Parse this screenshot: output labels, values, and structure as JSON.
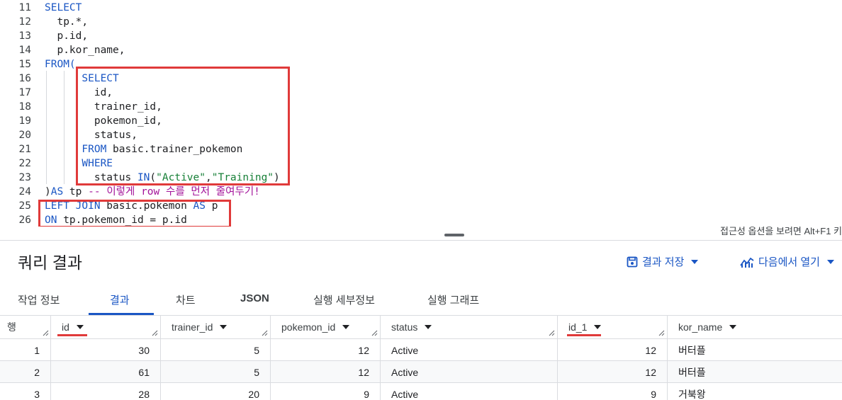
{
  "editor": {
    "lines": [
      {
        "num": "11",
        "tokens": [
          {
            "t": "SELECT",
            "c": "kw"
          }
        ]
      },
      {
        "num": "12",
        "tokens": [
          {
            "t": "  tp.*,",
            "c": "plain"
          }
        ]
      },
      {
        "num": "13",
        "tokens": [
          {
            "t": "  p.id,",
            "c": "plain"
          }
        ]
      },
      {
        "num": "14",
        "tokens": [
          {
            "t": "  p.kor_name,",
            "c": "plain"
          }
        ]
      },
      {
        "num": "15",
        "tokens": [
          {
            "t": "FROM(",
            "c": "kw"
          }
        ]
      },
      {
        "num": "16",
        "tokens": [
          {
            "t": "      ",
            "c": "plain"
          },
          {
            "t": "SELECT",
            "c": "kw"
          }
        ]
      },
      {
        "num": "17",
        "tokens": [
          {
            "t": "        id,",
            "c": "plain"
          }
        ]
      },
      {
        "num": "18",
        "tokens": [
          {
            "t": "        trainer_id,",
            "c": "plain"
          }
        ]
      },
      {
        "num": "19",
        "tokens": [
          {
            "t": "        pokemon_id,",
            "c": "plain"
          }
        ]
      },
      {
        "num": "20",
        "tokens": [
          {
            "t": "        status,",
            "c": "plain"
          }
        ]
      },
      {
        "num": "21",
        "tokens": [
          {
            "t": "      ",
            "c": "plain"
          },
          {
            "t": "FROM",
            "c": "kw"
          },
          {
            "t": " basic.trainer_pokemon",
            "c": "plain"
          }
        ]
      },
      {
        "num": "22",
        "tokens": [
          {
            "t": "      ",
            "c": "plain"
          },
          {
            "t": "WHERE",
            "c": "kw"
          }
        ]
      },
      {
        "num": "23",
        "tokens": [
          {
            "t": "        status ",
            "c": "plain"
          },
          {
            "t": "IN",
            "c": "kw"
          },
          {
            "t": "(",
            "c": "plain"
          },
          {
            "t": "\"Active\"",
            "c": "str"
          },
          {
            "t": ",",
            "c": "plain"
          },
          {
            "t": "\"Training\"",
            "c": "str"
          },
          {
            "t": ")",
            "c": "plain"
          }
        ]
      },
      {
        "num": "24",
        "tokens": [
          {
            "t": ")",
            "c": "plain"
          },
          {
            "t": "AS",
            "c": "kw"
          },
          {
            "t": " tp ",
            "c": "plain"
          },
          {
            "t": "-- 이렇게 row 수를 먼저 줄여두기!",
            "c": "cmt"
          }
        ]
      },
      {
        "num": "25",
        "tokens": [
          {
            "t": "LEFT JOIN",
            "c": "kw"
          },
          {
            "t": " basic.pokemon ",
            "c": "plain"
          },
          {
            "t": "AS",
            "c": "kw"
          },
          {
            "t": " p",
            "c": "plain"
          }
        ]
      },
      {
        "num": "26",
        "tokens": [
          {
            "t": "ON",
            "c": "kw"
          },
          {
            "t": " tp.pokemon_id = p.id",
            "c": "plain"
          }
        ]
      }
    ],
    "accessibility_hint": "접근성 옵션을 보려면 Alt+F1 키"
  },
  "results": {
    "title": "쿼리 결과",
    "save_label": "결과 저장",
    "open_label": "다음에서 열기",
    "tabs": [
      "작업 정보",
      "결과",
      "차트",
      "JSON",
      "실행 세부정보",
      "실행 그래프"
    ],
    "active_tab": "결과",
    "row_header": "행",
    "columns": [
      "id",
      "trainer_id",
      "pokemon_id",
      "status",
      "id_1",
      "kor_name"
    ],
    "rows": [
      {
        "n": "1",
        "cells": [
          "30",
          "5",
          "12",
          "Active",
          "12",
          "버터플"
        ]
      },
      {
        "n": "2",
        "cells": [
          "61",
          "5",
          "12",
          "Active",
          "12",
          "버터플"
        ]
      },
      {
        "n": "3",
        "cells": [
          "28",
          "20",
          "9",
          "Active",
          "9",
          "거북왕"
        ]
      }
    ]
  },
  "colors": {
    "accent": "#1a56c4",
    "highlight": "#e03a3a",
    "string": "#188038",
    "comment": "#a3139a"
  }
}
